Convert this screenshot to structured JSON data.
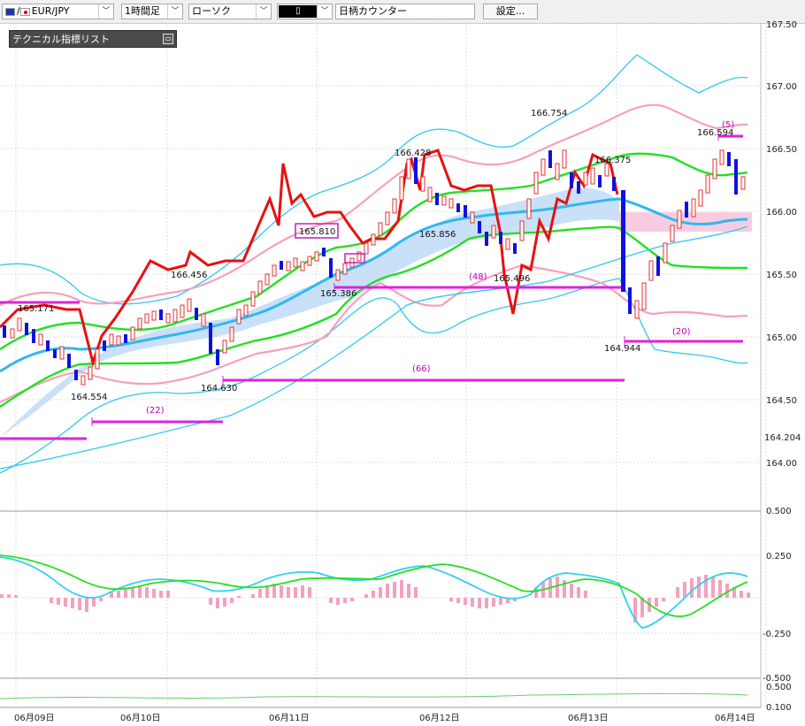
{
  "toolbar": {
    "symbol": "EUR/JPY",
    "timeframe": "1時間足",
    "chart_style": "ローソク",
    "brand_counter_label": "日柄カウンター",
    "settings_label": "設定..."
  },
  "indicator_panel": {
    "title": "テクニカル指標リスト"
  },
  "price_axis": {
    "labels": [
      "167.50",
      "167.00",
      "166.50",
      "166.00",
      "165.50",
      "165.00",
      "164.50",
      "164.204",
      "164.00"
    ]
  },
  "osc_axis": {
    "labels": [
      "0.500",
      "0.250",
      "-0.250",
      "-0.500"
    ]
  },
  "vol_axis": {
    "labels": [
      "0.500",
      "0.100"
    ]
  },
  "time_axis": {
    "labels": [
      "06月09日",
      "06月10日",
      "06月11日",
      "06月12日",
      "06月13日",
      "06月14日"
    ]
  },
  "annotations": {
    "prices": [
      "165.171",
      "164.554",
      "166.456",
      "164.630",
      "165.810",
      "165.386",
      "166.428",
      "165.856",
      "165.496",
      "166.754",
      "166.375",
      "164.944",
      "166.594"
    ],
    "counts": [
      "(22)",
      "(66)",
      "(48)",
      "(20)",
      "(5)"
    ]
  },
  "colors": {
    "up": "#e03030",
    "down": "#1010e0",
    "tenkan": "#ff0000",
    "green": "#22e022",
    "cyan": "#30c8f0",
    "pink": "#f4a0c0",
    "magenta": "#e020e0",
    "cloud": "#c8e0f8"
  },
  "chart_data": {
    "type": "line",
    "title": "EUR/JPY",
    "xlabel": "",
    "ylabel": "",
    "x": [
      "06月09日",
      "06月10日",
      "06月11日",
      "06月12日",
      "06月13日",
      "06月14日"
    ],
    "ylim": [
      163.9,
      167.55
    ],
    "series": [
      {
        "name": "",
        "values": [
          164.6,
          165.2,
          166.4,
          166.0,
          166.5,
          166.2
        ]
      }
    ],
    "marked_highs_lows": [
      165.171,
      164.554,
      166.456,
      164.63,
      165.81,
      165.386,
      166.428,
      165.856,
      165.496,
      166.754,
      166.375,
      164.944,
      166.594
    ]
  }
}
